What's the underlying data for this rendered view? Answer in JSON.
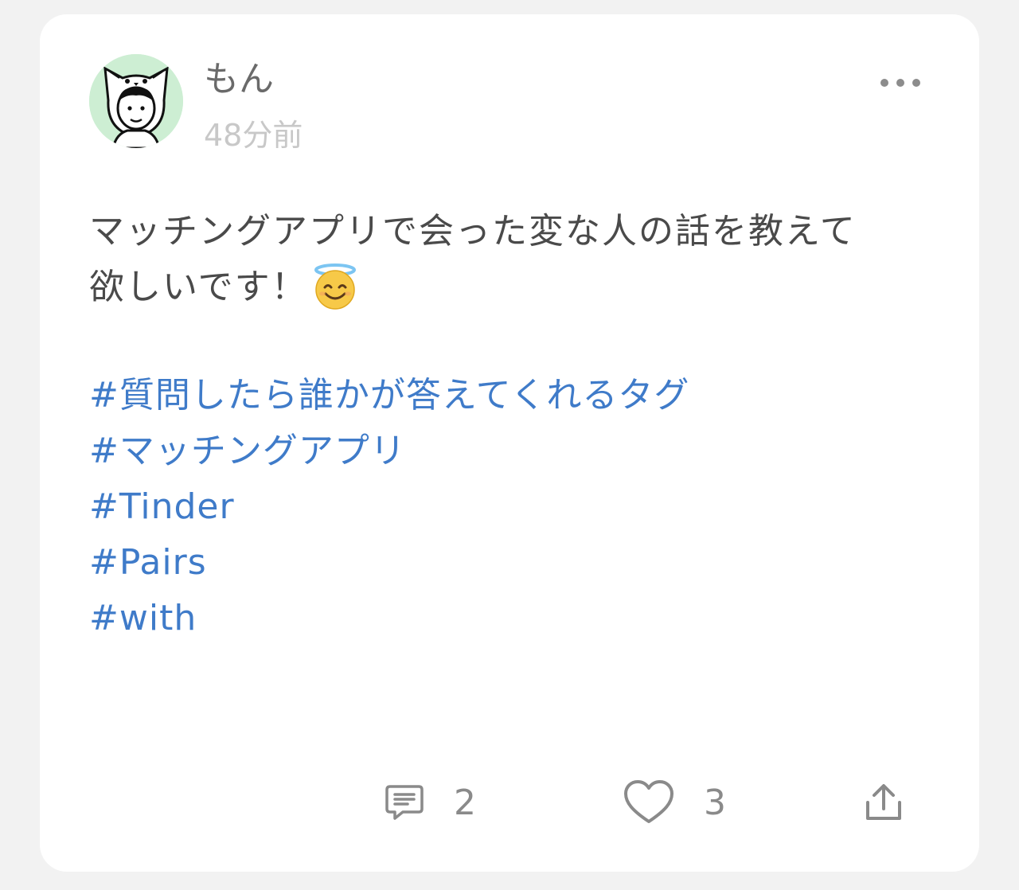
{
  "post": {
    "author": "もん",
    "time": "48分前",
    "body_line1": "マッチングアプリで会った変な人の話を教えて",
    "body_line2": "欲しいです！",
    "emoji": "smiling-face-with-halo",
    "tags": [
      "#質問したら誰かが答えてくれるタグ",
      "#マッチングアプリ",
      "#Tinder",
      "#Pairs",
      "#with"
    ]
  },
  "actions": {
    "comment_count": "2",
    "like_count": "3"
  },
  "colors": {
    "background": "#f2f2f2",
    "card": "#ffffff",
    "tag": "#3f7bc9",
    "avatar_bg": "#cdeed3"
  }
}
